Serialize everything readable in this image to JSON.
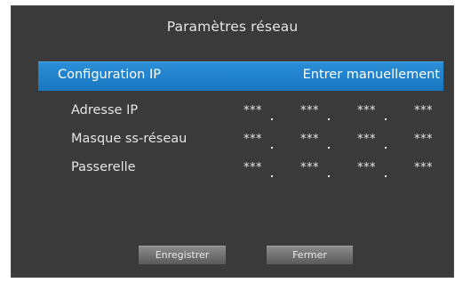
{
  "dialog": {
    "title": "Paramètres réseau",
    "ip_config": {
      "label": "Configuration IP",
      "value": "Entrer manuellement"
    },
    "fields": [
      {
        "label": "Adresse IP",
        "octets": [
          "***",
          "***",
          "***",
          "***"
        ]
      },
      {
        "label": "Masque ss-réseau",
        "octets": [
          "***",
          "***",
          "***",
          "***"
        ]
      },
      {
        "label": "Passerelle",
        "octets": [
          "***",
          "***",
          "***",
          "***"
        ]
      }
    ],
    "buttons": {
      "save_label": "Enregistrer",
      "close_label": "Fermer"
    }
  },
  "colors": {
    "dialog_background": "#3a3a3a",
    "highlight_blue": "#1f82cc",
    "text": "#e6e6e6",
    "button_gray": "#6e6e6e"
  }
}
